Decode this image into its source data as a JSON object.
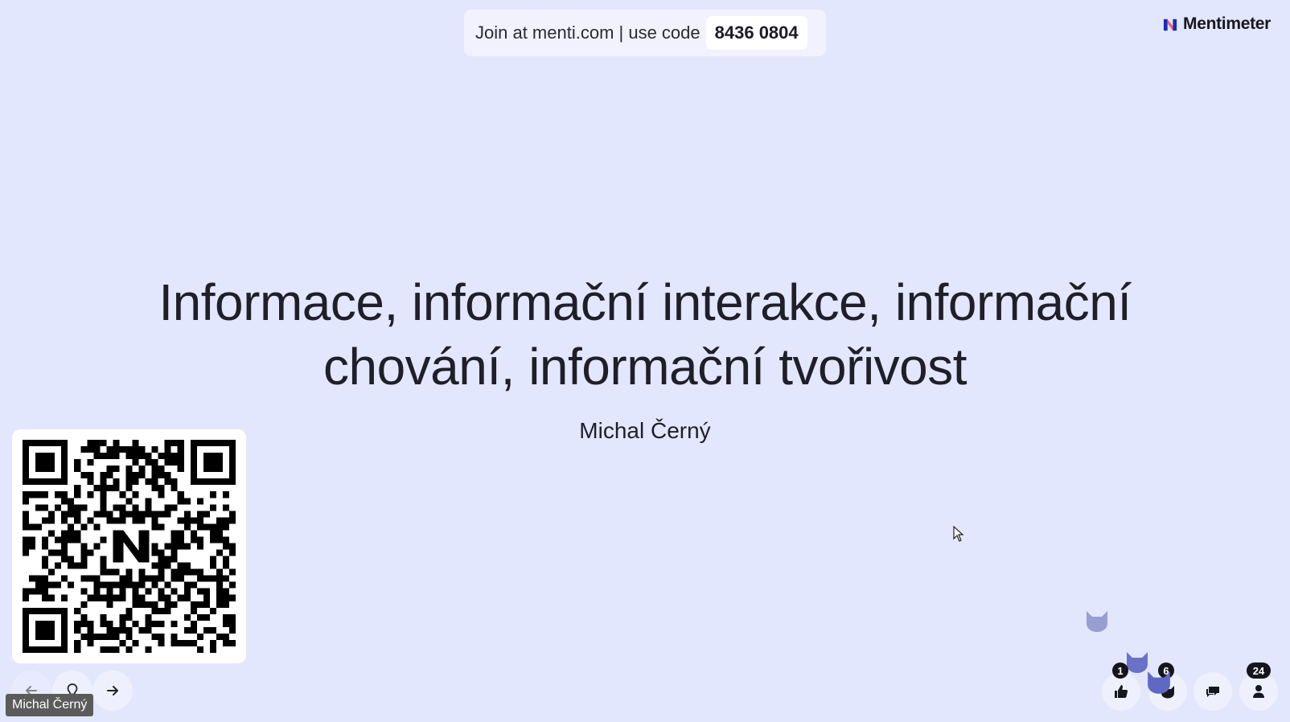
{
  "join": {
    "text": "Join at menti.com | use code",
    "code": "8436 0804"
  },
  "brand": {
    "name": "Mentimeter"
  },
  "slide": {
    "title": "Informace, informační interakce, informační chování, informační tvořivost",
    "author": "Michal Černý"
  },
  "presenter": {
    "name": "Michal Černý"
  },
  "reactions": {
    "likes": "1",
    "cats": "6",
    "participants": "24"
  },
  "colors": {
    "background": "#e3e7fd",
    "cat_reaction": "#6a72c8",
    "badge": "#15151d"
  },
  "icons": {
    "prev": "arrow-left-icon",
    "hint": "lightbulb-icon",
    "next": "arrow-right-icon",
    "like": "thumbs-up-icon",
    "cat": "cat-icon",
    "qa": "chat-bubbles-icon",
    "people": "person-icon"
  }
}
